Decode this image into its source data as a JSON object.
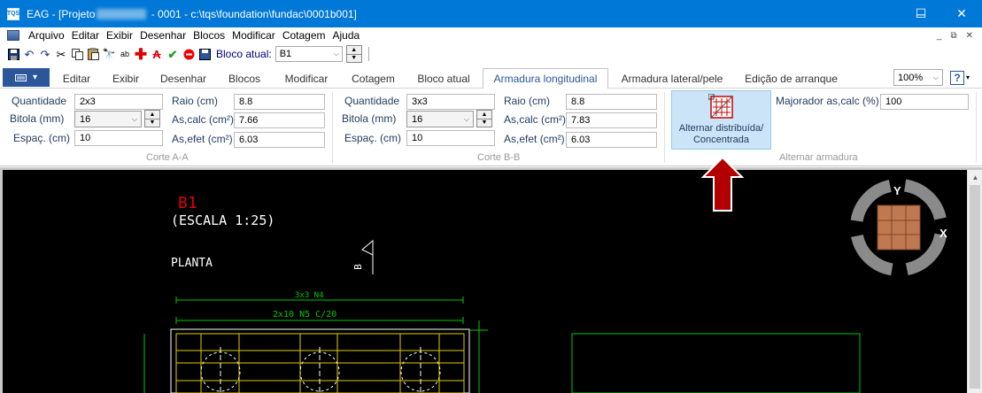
{
  "window": {
    "title_prefix": "EAG - [Projeto",
    "title_suffix": " - 0001 - c:\\tqs\\foundation\\fundac\\0001b001]",
    "icon_label": "TQS",
    "minimize": "─",
    "maximize": "☐",
    "close": "✕"
  },
  "menu": {
    "items": [
      "Arquivo",
      "Editar",
      "Exibir",
      "Desenhar",
      "Blocos",
      "Modificar",
      "Cotagem",
      "Ajuda"
    ]
  },
  "toolbar": {
    "bloco_label": "Bloco atual:",
    "bloco_value": "B1"
  },
  "tabs": {
    "items": [
      "Editar",
      "Exibir",
      "Desenhar",
      "Blocos",
      "Modificar",
      "Cotagem",
      "Bloco atual",
      "Armadura longitudinal",
      "Armadura lateral/pele",
      "Edição de arranque"
    ],
    "active": "Armadura longitudinal",
    "zoom": "100%",
    "help": "?"
  },
  "corte_a": {
    "caption": "Corte A-A",
    "quantidade_label": "Quantidade",
    "quantidade": "2x3",
    "bitola_label": "Bitola (mm)",
    "bitola": "16",
    "espac_label": "Espaç. (cm)",
    "espac": "10",
    "raio_label": "Raio (cm)",
    "raio": "8.8",
    "ascalc_label": "As,calc (cm²)",
    "ascalc": "7.66",
    "asefet_label": "As,efet (cm²)",
    "asefet": "6.03"
  },
  "corte_b": {
    "caption": "Corte B-B",
    "quantidade_label": "Quantidade",
    "quantidade": "3x3",
    "bitola_label": "Bitola (mm)",
    "bitola": "16",
    "espac_label": "Espaç. (cm)",
    "espac": "10",
    "raio_label": "Raio (cm)",
    "raio": "8.8",
    "ascalc_label": "As,calc (cm²)",
    "ascalc": "7.83",
    "asefet_label": "As,efet (cm²)",
    "asefet": "6.03"
  },
  "alternar": {
    "caption": "Alternar armadura",
    "button_line1": "Alternar distribuída/",
    "button_line2": "Concentrada",
    "majorador_label": "Majorador as,calc (%)",
    "majorador": "100"
  },
  "drawing": {
    "block_name": "B1",
    "scale": "(ESCALA 1:25)",
    "planta": "PLANTA",
    "section_mark": "B",
    "dim1": "3x3  N4",
    "dim2": "2x10  N5  C/20",
    "compass_y": "Y",
    "compass_x": "X"
  },
  "colors": {
    "titlebar": "#0078d7",
    "file_tab": "#2b579a",
    "button_selected": "#cce4f7",
    "arrow": "#b20000",
    "cad_green": "#00c800",
    "cad_red": "#e00000",
    "cad_yellow": "#e0d000"
  }
}
